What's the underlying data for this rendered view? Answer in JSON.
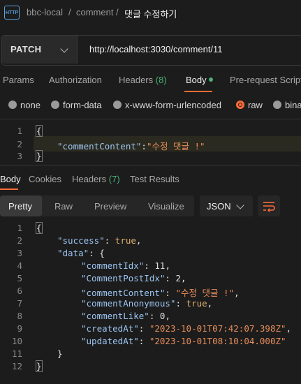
{
  "header": {
    "app_icon": "http-icon",
    "icon_text": "HTTP",
    "breadcrumb": [
      "bbc-local",
      "/",
      "comment",
      "/",
      "댓글 수정하기"
    ]
  },
  "request": {
    "method": "PATCH",
    "url": "http://localhost:3030/comment/11"
  },
  "tabs": {
    "params": "Params",
    "authorization": "Authorization",
    "headers": "Headers",
    "headers_count": "(8)",
    "body": "Body",
    "prerequest": "Pre-request Script"
  },
  "body_types": {
    "none": "none",
    "form_data": "form-data",
    "urlencoded": "x-www-form-urlencoded",
    "raw": "raw",
    "binary": "binary",
    "selected": "raw"
  },
  "request_body": {
    "line_numbers": [
      "1",
      "2",
      "3"
    ],
    "open_brace": "{",
    "line2_key": "\"commentContent\"",
    "line2_sep": ":",
    "line2_value": "\"수정 댓글 !\"",
    "close_brace": "}"
  },
  "response_tabs": {
    "body": "Body",
    "cookies": "Cookies",
    "headers": "Headers",
    "headers_count": "(7)",
    "test_results": "Test Results"
  },
  "view_modes": {
    "pretty": "Pretty",
    "raw": "Raw",
    "preview": "Preview",
    "visualize": "Visualize",
    "format": "JSON",
    "wrap_icon": "wrap-lines-icon"
  },
  "response_body": {
    "line_numbers": [
      "1",
      "2",
      "3",
      "4",
      "5",
      "6",
      "7",
      "8",
      "9",
      "10",
      "11",
      "12"
    ],
    "l1": "{",
    "success_key": "\"success\"",
    "success_val": "true",
    "data_key": "\"data\"",
    "data_open": "{",
    "commentIdx_key": "\"commentIdx\"",
    "commentIdx_val": "11",
    "CommentPostIdx_key": "\"CommentPostIdx\"",
    "CommentPostIdx_val": "2",
    "commentContent_key": "\"commentContent\"",
    "commentContent_val": "\"수정 댓글 !\"",
    "commentAnonymous_key": "\"commentAnonymous\"",
    "commentAnonymous_val": "true",
    "commentLike_key": "\"commentLike\"",
    "commentLike_val": "0",
    "createdAt_key": "\"createdAt\"",
    "createdAt_val": "\"2023-10-01T07:42:07.398Z\"",
    "updatedAt_key": "\"updatedAt\"",
    "updatedAt_val": "\"2023-10-01T08:10:04.000Z\"",
    "data_close": "}",
    "l12": "}"
  },
  "colors": {
    "accent": "#ff6c37",
    "status_green": "#49b07a",
    "json_key": "#9cc4f0",
    "json_string": "#e88e5a"
  }
}
